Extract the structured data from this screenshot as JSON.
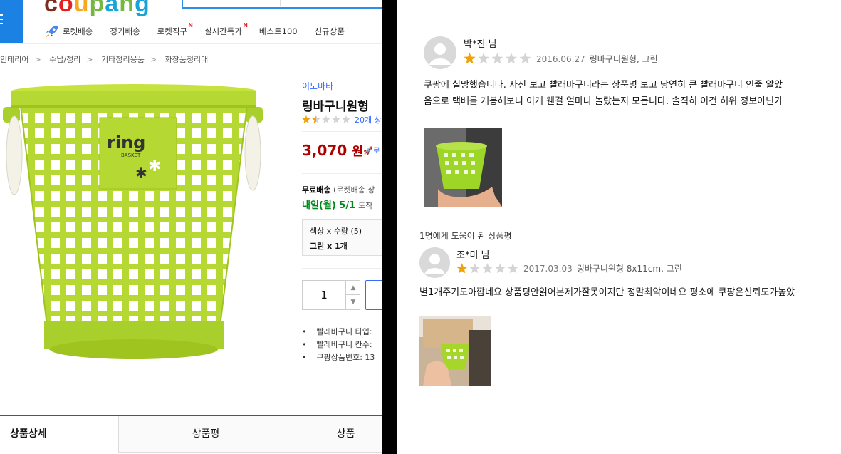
{
  "header": {
    "logo_text": "coupang",
    "nav": [
      {
        "label": "로켓배송",
        "badge": ""
      },
      {
        "label": "정기배송",
        "badge": ""
      },
      {
        "label": "로켓직구",
        "badge": "N"
      },
      {
        "label": "실시간특가",
        "badge": "N"
      },
      {
        "label": "베스트100",
        "badge": ""
      },
      {
        "label": "신규상품",
        "badge": ""
      }
    ]
  },
  "breadcrumbs": [
    "인테리어",
    "수납/정리",
    "기타정리용품",
    "화장품정리대"
  ],
  "product": {
    "image_text": "ring",
    "image_subtext": "BASKET",
    "brand": "이노마타",
    "name": "링바구니원형",
    "rating_fraction": 0.3,
    "review_count": "20개 상",
    "price": "3,070",
    "price_unit": "원",
    "rocket_label": "로",
    "shipping_free": "무료배송",
    "shipping_sub": "(로켓배송 상",
    "delivery": "내일(월) 5/1",
    "delivery_suffix": "도착",
    "option_label": "색상 x 수량 (5)",
    "option_value": "그린 x 1개",
    "quantity": "1",
    "bullets": [
      "빨래바구니 타입:",
      "빨래바구니 칸수:",
      "쿠팡상품번호: 13"
    ]
  },
  "tabs": [
    {
      "label": "상품상세",
      "active": true
    },
    {
      "label": "상품평",
      "active": false
    },
    {
      "label": "상품",
      "active": false
    }
  ],
  "reviews": [
    {
      "author": "박*진 님",
      "rating": 1,
      "date": "2016.06.27",
      "option": "링바구니원형, 그린",
      "lines": [
        "쿠팡에 실망했습니다. 사진 보고 빨래바구니라는 상품명 보고 당연히 큰 빨래바구니 인줄 알았",
        "음으로 택배를 개봉해보니 이게 웬걸 얼마나 놀랐는지 모릅니다. 솔직히 이건 허위 정보아닌가"
      ],
      "helpful": ""
    },
    {
      "author": "조*미 님",
      "rating": 1,
      "date": "2017.03.03",
      "option": "링바구니원형 8x11cm, 그린",
      "lines": [
        "별1개주기도아깝네요 상품평안읽어본제가잘못이지만 정말최악이네요 평소에 쿠팡은신뢰도가높았"
      ],
      "helpful": "1명에게 도움이 된 상품평"
    }
  ],
  "colors": {
    "accent_blue": "#346aff",
    "price_red": "#ae0000",
    "delivery_green": "#00891a",
    "star_orange": "#f2a100",
    "basket_green": "#b5d932"
  }
}
